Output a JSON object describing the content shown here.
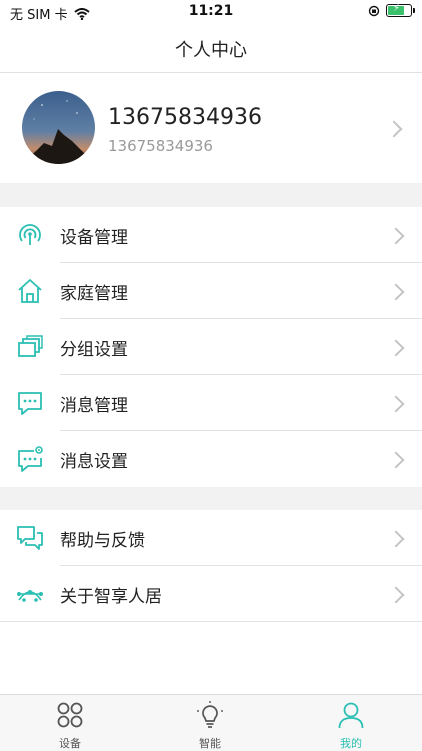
{
  "status_bar": {
    "carrier": "无 SIM 卡",
    "time": "11:21"
  },
  "nav": {
    "title": "个人中心"
  },
  "profile": {
    "name": "13675834936",
    "account": "13675834936"
  },
  "menu_group_1": [
    {
      "label": "设备管理",
      "icon": "device-signal-icon"
    },
    {
      "label": "家庭管理",
      "icon": "home-icon"
    },
    {
      "label": "分组设置",
      "icon": "group-layers-icon"
    },
    {
      "label": "消息管理",
      "icon": "message-icon"
    },
    {
      "label": "消息设置",
      "icon": "message-settings-icon"
    }
  ],
  "menu_group_2": [
    {
      "label": "帮助与反馈",
      "icon": "feedback-icon"
    },
    {
      "label": "关于智享人居",
      "icon": "about-icon"
    }
  ],
  "tab_bar": {
    "tabs": [
      {
        "label": "设备",
        "icon": "device-grid-icon"
      },
      {
        "label": "智能",
        "icon": "bulb-icon"
      },
      {
        "label": "我的",
        "icon": "user-icon"
      }
    ],
    "active": "我的"
  },
  "colors": {
    "accent": "#2bbfb3",
    "separator": "#f2f2f2",
    "text": "#222222",
    "muted": "#9a9a9a"
  }
}
